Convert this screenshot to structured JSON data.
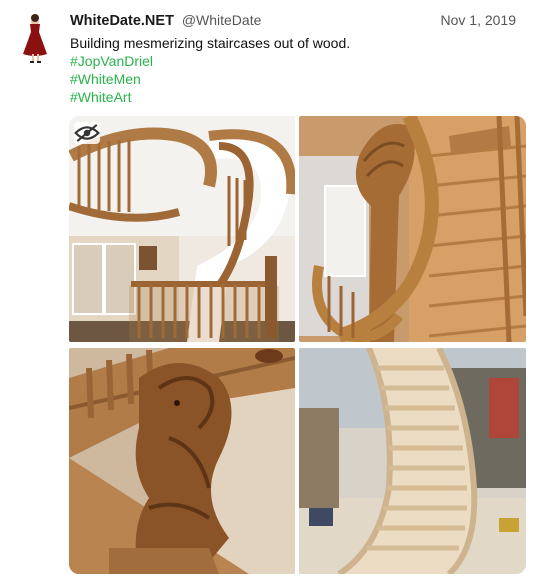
{
  "tweet": {
    "display_name": "WhiteDate.NET",
    "handle": "@WhiteDate",
    "date": "Nov 1, 2019",
    "text": "Building mesmerizing staircases out of wood.",
    "hashtags": [
      "#JopVanDriel",
      "#WhiteMen",
      "#WhiteArt"
    ]
  },
  "media": {
    "images": [
      {
        "icon": "spiral-staircase-photo"
      },
      {
        "icon": "carved-newel-staircase-photo"
      },
      {
        "icon": "horse-carving-staircase-photo"
      },
      {
        "icon": "workshop-staircase-photo"
      }
    ],
    "hide_icon": "eye-slash-icon"
  },
  "colors": {
    "hashtag": "#28b24a",
    "meta": "#555555",
    "avatar_dress": "#8b1010"
  }
}
